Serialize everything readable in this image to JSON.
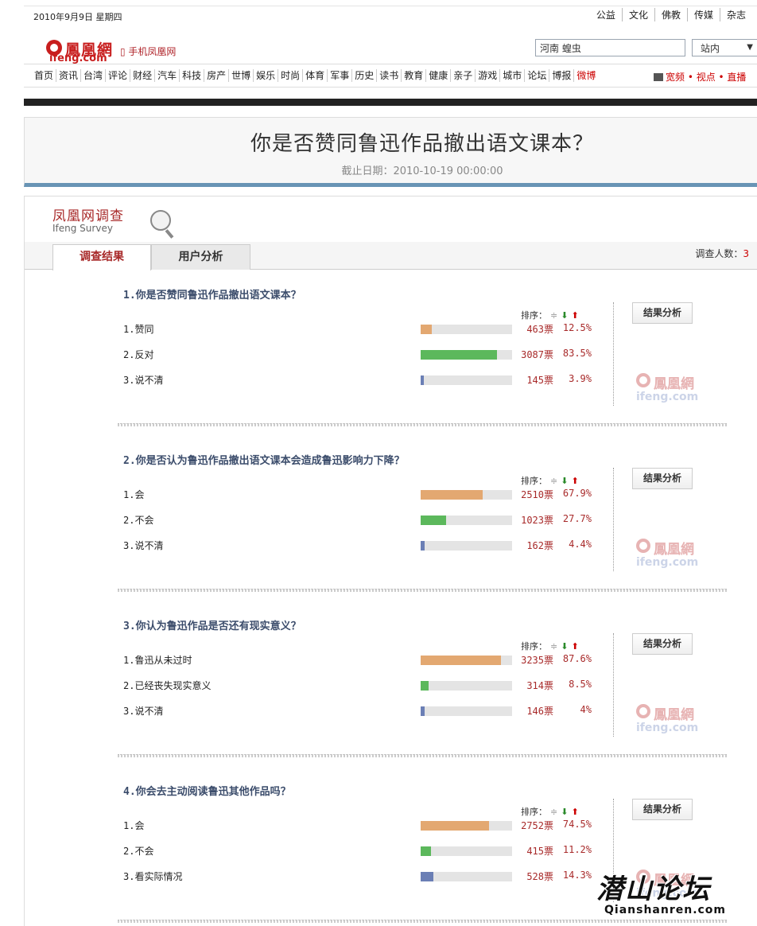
{
  "header": {
    "date": "2010年9月9日 星期四",
    "top_links": [
      "公益",
      "文化",
      "佛教",
      "传媒",
      "杂志"
    ],
    "logo_cn": "鳳凰網",
    "logo_en": "ifeng.com",
    "mobile_link": "手机凤凰网",
    "search_value": "河南 蝗虫",
    "search_scope": "站内",
    "nav_items": [
      "首页",
      "资讯",
      "台湾",
      "评论",
      "财经",
      "汽车",
      "科技",
      "房产",
      "世博",
      "娱乐",
      "时尚",
      "体育",
      "军事",
      "历史",
      "读书",
      "教育",
      "健康",
      "亲子",
      "游戏",
      "城市",
      "论坛",
      "博报",
      "微博"
    ],
    "nav_right": "宽频 • 视点 • 直播"
  },
  "survey": {
    "title": "你是否赞同鲁迅作品撤出语文课本？",
    "deadline": "截止日期：2010-10-19 00:00:00",
    "brand_cn": "凤凰网调查",
    "brand_en": "Ifeng Survey",
    "tabs": [
      "调查结果",
      "用户分析"
    ],
    "participants_label": "调查人数：",
    "participants_value": "3",
    "sort_label": "排序：",
    "result_button": "结果分析",
    "watermark_cn": "鳳凰網",
    "watermark_en": "ifeng.com",
    "accent_colors": {
      "orange": "#e3a871",
      "green": "#5cb85c",
      "blue": "#6b7fb5"
    },
    "questions": [
      {
        "title": "1.你是否赞同鲁迅作品撤出语文课本？",
        "options": [
          {
            "label": "1.赞同",
            "votes": "463票",
            "pct": "12.5%",
            "value": 12.5,
            "color": "#e3a871"
          },
          {
            "label": "2.反对",
            "votes": "3087票",
            "pct": "83.5%",
            "value": 83.5,
            "color": "#5cb85c"
          },
          {
            "label": "3.说不清",
            "votes": "145票",
            "pct": "3.9%",
            "value": 3.9,
            "color": "#6b7fb5"
          }
        ]
      },
      {
        "title": "2.你是否认为鲁迅作品撤出语文课本会造成鲁迅影响力下降？",
        "options": [
          {
            "label": "1.会",
            "votes": "2510票",
            "pct": "67.9%",
            "value": 67.9,
            "color": "#e3a871"
          },
          {
            "label": "2.不会",
            "votes": "1023票",
            "pct": "27.7%",
            "value": 27.7,
            "color": "#5cb85c"
          },
          {
            "label": "3.说不清",
            "votes": "162票",
            "pct": "4.4%",
            "value": 4.4,
            "color": "#6b7fb5"
          }
        ]
      },
      {
        "title": "3.你认为鲁迅作品是否还有现实意义？",
        "options": [
          {
            "label": "1.鲁迅从未过时",
            "votes": "3235票",
            "pct": "87.6%",
            "value": 87.6,
            "color": "#e3a871"
          },
          {
            "label": "2.已经丧失现实意义",
            "votes": "314票",
            "pct": "8.5%",
            "value": 8.5,
            "color": "#5cb85c"
          },
          {
            "label": "3.说不清",
            "votes": "146票",
            "pct": "4%",
            "value": 4,
            "color": "#6b7fb5"
          }
        ]
      },
      {
        "title": "4.你会去主动阅读鲁迅其他作品吗？",
        "options": [
          {
            "label": "1.会",
            "votes": "2752票",
            "pct": "74.5%",
            "value": 74.5,
            "color": "#e3a871"
          },
          {
            "label": "2.不会",
            "votes": "415票",
            "pct": "11.2%",
            "value": 11.2,
            "color": "#5cb85c"
          },
          {
            "label": "3.看实际情况",
            "votes": "528票",
            "pct": "14.3%",
            "value": 14.3,
            "color": "#6b7fb5"
          }
        ]
      }
    ]
  },
  "forum_watermark": {
    "cn": "潜山论坛",
    "en": "Qianshanren.com"
  }
}
